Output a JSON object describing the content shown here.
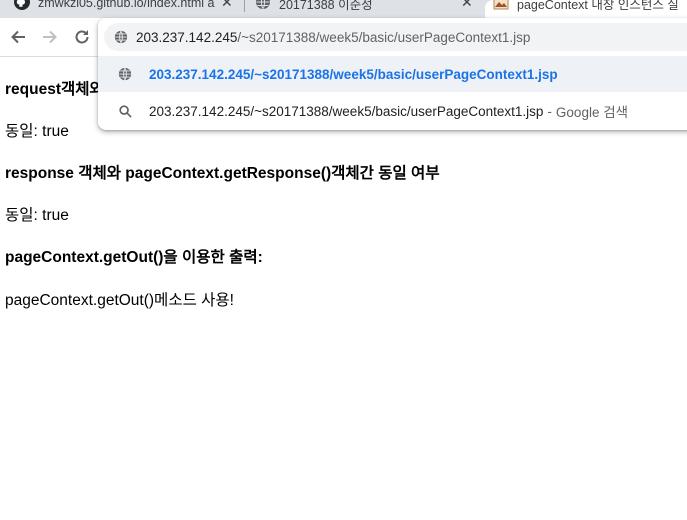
{
  "tabs": [
    {
      "title": "zmwkzl05.github.io/index.html a",
      "icon": "github-icon"
    },
    {
      "title": "20171388 이준성",
      "icon": "globe-icon"
    },
    {
      "title": "pageContext 내장 인스턴스 실",
      "icon": "image-icon"
    }
  ],
  "omnibox": {
    "host": "203.237.142.245",
    "path": "/~s20171388/week5/basic/userPageContext1.jsp",
    "suggestions": [
      {
        "text": "203.237.142.245/~s20171388/week5/basic/userPageContext1.jsp",
        "icon": "globe-icon"
      },
      {
        "text": "203.237.142.245/~s20171388/week5/basic/userPageContext1.jsp",
        "separator": "-",
        "desc": "Google 검색",
        "icon": "search-icon"
      }
    ]
  },
  "page": {
    "heading1": "request객체와 pageContext.getRequest()객체간 동일 여부",
    "result1": "동일: true",
    "heading2": "response 객체와 pageContext.getResponse()객체간 동일 여부",
    "result2": "동일: true",
    "heading3": "pageContext.getOut()을 이용한 출력:",
    "output": "pageContext.getOut()메소드 사용!"
  }
}
